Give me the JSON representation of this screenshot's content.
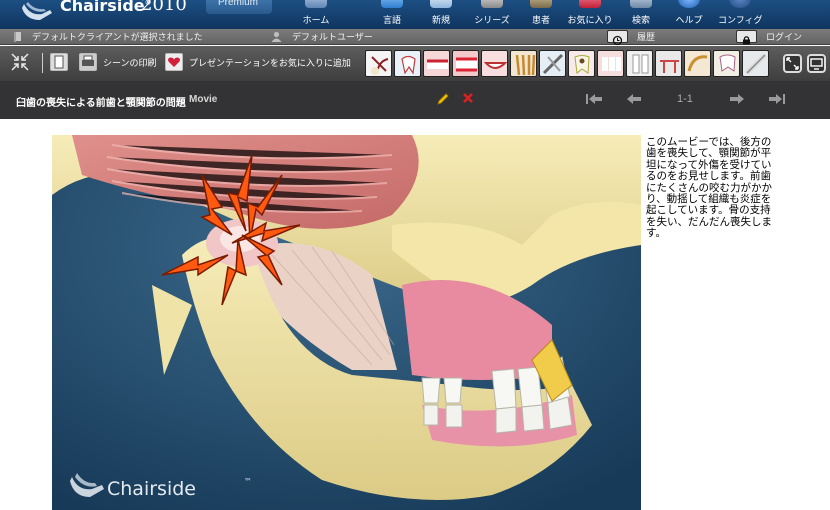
{
  "header": {
    "brand": "Chairside",
    "brand_reg": "®",
    "brand_year": "2010",
    "edition": "Premium",
    "nav": [
      {
        "label": "ホーム",
        "icon": "home-icon"
      },
      {
        "label": "言語",
        "icon": "language-icon"
      },
      {
        "label": "新規",
        "icon": "new-icon"
      },
      {
        "label": "シリーズ",
        "icon": "series-icon"
      },
      {
        "label": "患者",
        "icon": "patient-icon"
      },
      {
        "label": "お気に入り",
        "icon": "favorites-icon"
      },
      {
        "label": "検索",
        "icon": "search-icon"
      },
      {
        "label": "ヘルプ",
        "icon": "help-icon"
      },
      {
        "label": "コンフィグ",
        "icon": "config-icon"
      }
    ]
  },
  "status": {
    "client": "デフォルトクライアントが選択されました",
    "user": "デフォルトユーザー",
    "history": "履歴",
    "login": "ログイン"
  },
  "toolbar": {
    "print_scene": "シーンの印刷",
    "add_favorite": "プレゼンテーションをお気に入りに追加"
  },
  "scene": {
    "title": "臼歯の喪失による前歯と顎関節の問題",
    "type": "Movie",
    "page": "1-1"
  },
  "content": {
    "watermark": "Chairside",
    "watermark_tm": "™",
    "description": "このムービーでは、後方の歯を喪失して、顎関節が平坦になって外傷を受けているのをお見せします。前歯にたくさんの咬む力がかかり、動揺して組織も炎症を起こしています。骨の支持を失い、だんだん喪失します。"
  },
  "colors": {
    "header_blue": "#1d4f83",
    "toolbar_grey": "#4c4c4c",
    "title_bar": "#333335",
    "edit_yellow": "#f2c200",
    "delete_red": "#e02020",
    "movie_background": "#1e4768"
  }
}
